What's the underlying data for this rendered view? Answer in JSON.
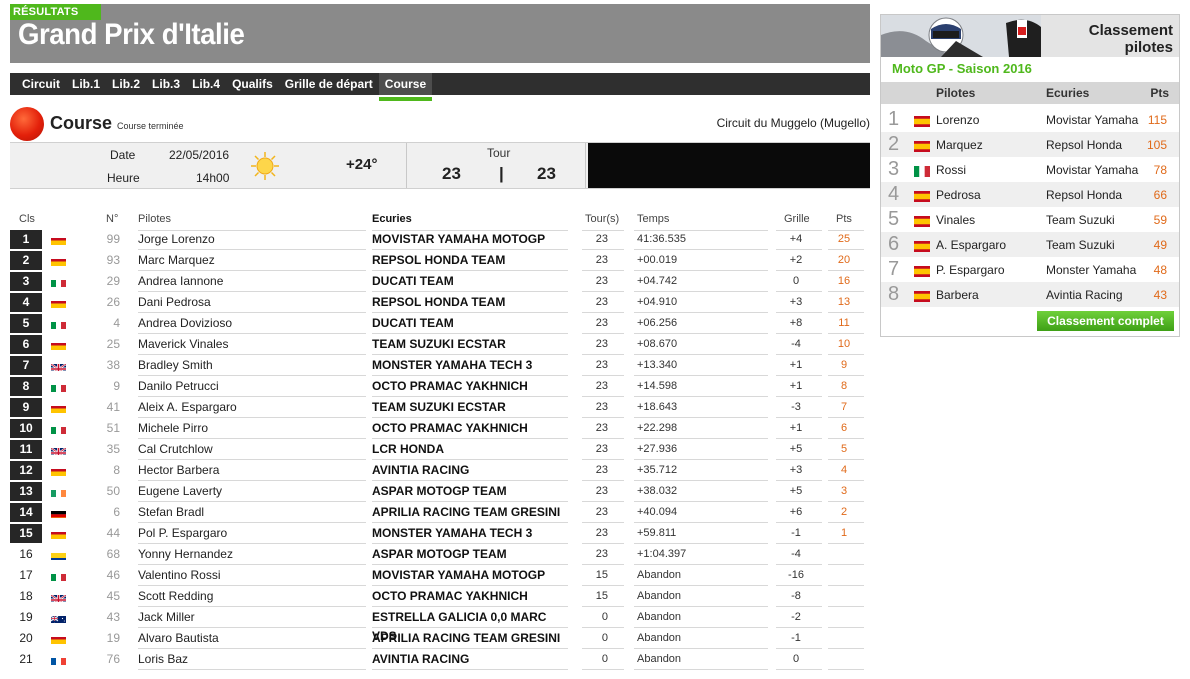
{
  "header": {
    "tag": "RÉSULTATS",
    "title": "Grand Prix d'Italie"
  },
  "tabs": [
    {
      "label": "Circuit"
    },
    {
      "label": "Lib.1"
    },
    {
      "label": "Lib.2"
    },
    {
      "label": "Lib.3"
    },
    {
      "label": "Lib.4"
    },
    {
      "label": "Qualifs"
    },
    {
      "label": "Grille de départ"
    },
    {
      "label": "Course",
      "active": true
    }
  ],
  "session": {
    "title": "Course",
    "status": "Course terminée",
    "circuit": "Circuit du Muggelo (Mugello)"
  },
  "info": {
    "date_label": "Date",
    "date_value": "22/05/2016",
    "time_label": "Heure",
    "time_value": "14h00",
    "weather_icon": "sun-icon",
    "temperature": "+24°",
    "tour_label": "Tour",
    "tour_done": "23",
    "tour_sep": "|",
    "tour_total": "23"
  },
  "results": {
    "columns": {
      "pos": "Cls",
      "num": "N°",
      "driver": "Pilotes",
      "team": "Ecuries",
      "laps": "Tour(s)",
      "time": "Temps",
      "grid": "Grille",
      "pts": "Pts"
    },
    "rows": [
      {
        "pos": "1",
        "flag": "es",
        "num": "99",
        "driver": "Jorge Lorenzo",
        "team": "MOVISTAR YAMAHA MOTOGP",
        "laps": "23",
        "time": "41:36.535",
        "grid": "+4",
        "pts": "25"
      },
      {
        "pos": "2",
        "flag": "es",
        "num": "93",
        "driver": "Marc Marquez",
        "team": "REPSOL HONDA TEAM",
        "laps": "23",
        "time": "+00.019",
        "grid": "+2",
        "pts": "20"
      },
      {
        "pos": "3",
        "flag": "it",
        "num": "29",
        "driver": "Andrea Iannone",
        "team": "DUCATI TEAM",
        "laps": "23",
        "time": "+04.742",
        "grid": "0",
        "pts": "16"
      },
      {
        "pos": "4",
        "flag": "es",
        "num": "26",
        "driver": "Dani Pedrosa",
        "team": "REPSOL HONDA TEAM",
        "laps": "23",
        "time": "+04.910",
        "grid": "+3",
        "pts": "13"
      },
      {
        "pos": "5",
        "flag": "it",
        "num": "4",
        "driver": "Andrea Dovizioso",
        "team": "DUCATI TEAM",
        "laps": "23",
        "time": "+06.256",
        "grid": "+8",
        "pts": "11"
      },
      {
        "pos": "6",
        "flag": "es",
        "num": "25",
        "driver": "Maverick Vinales",
        "team": "TEAM SUZUKI ECSTAR",
        "laps": "23",
        "time": "+08.670",
        "grid": "-4",
        "pts": "10"
      },
      {
        "pos": "7",
        "flag": "gb",
        "num": "38",
        "driver": "Bradley Smith",
        "team": "MONSTER YAMAHA TECH 3",
        "laps": "23",
        "time": "+13.340",
        "grid": "+1",
        "pts": "9"
      },
      {
        "pos": "8",
        "flag": "it",
        "num": "9",
        "driver": "Danilo Petrucci",
        "team": "OCTO PRAMAC YAKHNICH",
        "laps": "23",
        "time": "+14.598",
        "grid": "+1",
        "pts": "8"
      },
      {
        "pos": "9",
        "flag": "es",
        "num": "41",
        "driver": "Aleix A. Espargaro",
        "team": "TEAM SUZUKI ECSTAR",
        "laps": "23",
        "time": "+18.643",
        "grid": "-3",
        "pts": "7"
      },
      {
        "pos": "10",
        "flag": "it",
        "num": "51",
        "driver": "Michele Pirro",
        "team": "OCTO PRAMAC YAKHNICH",
        "laps": "23",
        "time": "+22.298",
        "grid": "+1",
        "pts": "6"
      },
      {
        "pos": "11",
        "flag": "gb",
        "num": "35",
        "driver": "Cal Crutchlow",
        "team": "LCR HONDA",
        "laps": "23",
        "time": "+27.936",
        "grid": "+5",
        "pts": "5"
      },
      {
        "pos": "12",
        "flag": "es",
        "num": "8",
        "driver": "Hector Barbera",
        "team": "AVINTIA RACING",
        "laps": "23",
        "time": "+35.712",
        "grid": "+3",
        "pts": "4"
      },
      {
        "pos": "13",
        "flag": "ie",
        "num": "50",
        "driver": "Eugene Laverty",
        "team": "ASPAR MOTOGP TEAM",
        "laps": "23",
        "time": "+38.032",
        "grid": "+5",
        "pts": "3"
      },
      {
        "pos": "14",
        "flag": "de",
        "num": "6",
        "driver": "Stefan Bradl",
        "team": "APRILIA RACING TEAM GRESINI",
        "laps": "23",
        "time": "+40.094",
        "grid": "+6",
        "pts": "2"
      },
      {
        "pos": "15",
        "flag": "es",
        "num": "44",
        "driver": "Pol P. Espargaro",
        "team": "MONSTER YAMAHA TECH 3",
        "laps": "23",
        "time": "+59.811",
        "grid": "-1",
        "pts": "1"
      },
      {
        "pos": "16",
        "flag": "co",
        "num": "68",
        "driver": "Yonny Hernandez",
        "team": "ASPAR MOTOGP TEAM",
        "laps": "23",
        "time": "+1:04.397",
        "grid": "-4",
        "pts": ""
      },
      {
        "pos": "17",
        "flag": "it",
        "num": "46",
        "driver": "Valentino Rossi",
        "team": "MOVISTAR YAMAHA MOTOGP",
        "laps": "15",
        "time": "Abandon",
        "grid": "-16",
        "pts": ""
      },
      {
        "pos": "18",
        "flag": "gb",
        "num": "45",
        "driver": "Scott Redding",
        "team": "OCTO PRAMAC YAKHNICH",
        "laps": "15",
        "time": "Abandon",
        "grid": "-8",
        "pts": ""
      },
      {
        "pos": "19",
        "flag": "au",
        "num": "43",
        "driver": "Jack Miller",
        "team": "ESTRELLA GALICIA 0,0 MARC VDS",
        "laps": "0",
        "time": "Abandon",
        "grid": "-2",
        "pts": ""
      },
      {
        "pos": "20",
        "flag": "es",
        "num": "19",
        "driver": "Alvaro Bautista",
        "team": "APRILIA RACING TEAM GRESINI",
        "laps": "0",
        "time": "Abandon",
        "grid": "-1",
        "pts": ""
      },
      {
        "pos": "21",
        "flag": "fr",
        "num": "76",
        "driver": "Loris Baz",
        "team": "AVINTIA RACING",
        "laps": "0",
        "time": "Abandon",
        "grid": "0",
        "pts": ""
      }
    ]
  },
  "standings": {
    "title_line1": "Classement",
    "title_line2": "pilotes",
    "subtitle": "Moto GP - Saison 2016",
    "columns": {
      "driver": "Pilotes",
      "team": "Ecuries",
      "pts": "Pts"
    },
    "rows": [
      {
        "rank": "1",
        "flag": "es",
        "driver": "Lorenzo",
        "team": "Movistar Yamaha",
        "pts": "115"
      },
      {
        "rank": "2",
        "flag": "es",
        "driver": "Marquez",
        "team": "Repsol Honda",
        "pts": "105"
      },
      {
        "rank": "3",
        "flag": "it",
        "driver": "Rossi",
        "team": "Movistar Yamaha",
        "pts": "78"
      },
      {
        "rank": "4",
        "flag": "es",
        "driver": "Pedrosa",
        "team": "Repsol Honda",
        "pts": "66"
      },
      {
        "rank": "5",
        "flag": "es",
        "driver": "Vinales",
        "team": "Team Suzuki",
        "pts": "59"
      },
      {
        "rank": "6",
        "flag": "es",
        "driver": "A. Espargaro",
        "team": "Team Suzuki",
        "pts": "49"
      },
      {
        "rank": "7",
        "flag": "es",
        "driver": "P. Espargaro",
        "team": "Monster Yamaha",
        "pts": "48"
      },
      {
        "rank": "8",
        "flag": "es",
        "driver": "Barbera",
        "team": "Avintia Racing",
        "pts": "43"
      }
    ],
    "button_label": "Classement complet"
  },
  "colors": {
    "accent_green": "#4fb81c",
    "points_orange": "#e06a1a",
    "header_grey": "#8a8a8a",
    "tab_bar": "#2f2f2f"
  }
}
